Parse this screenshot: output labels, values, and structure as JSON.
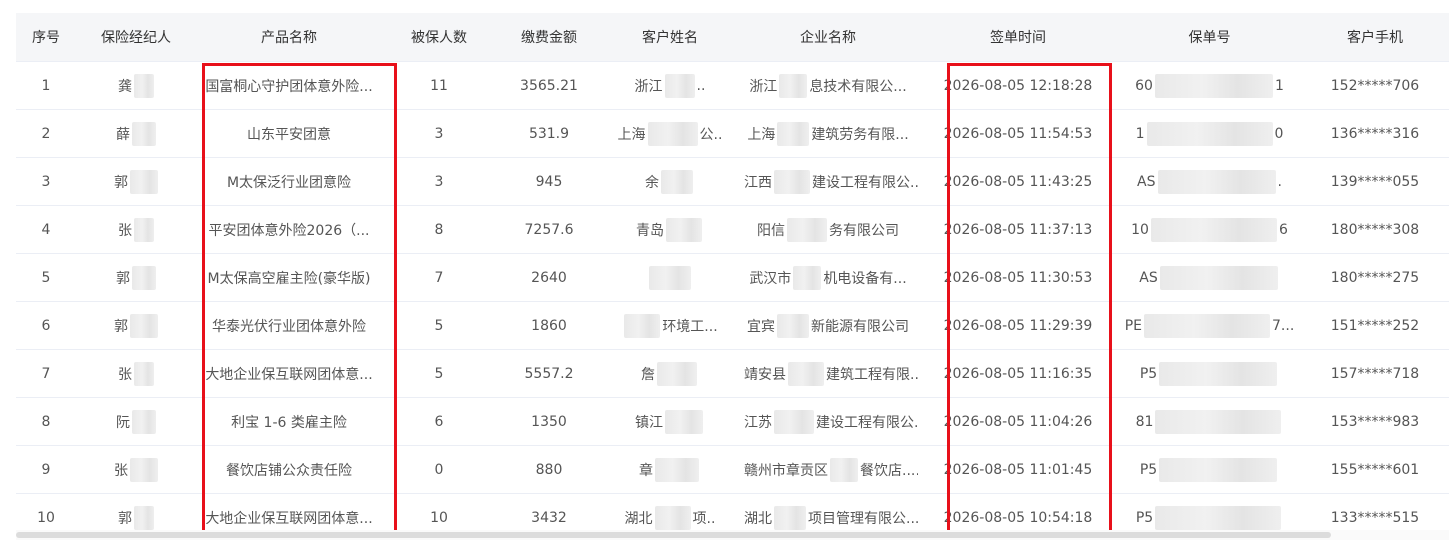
{
  "table": {
    "headers": [
      "序号",
      "保险经纪人",
      "产品名称",
      "被保人数",
      "缴费金额",
      "客户姓名",
      "企业名称",
      "签单时间",
      "保单号",
      "客户手机"
    ],
    "rows": [
      {
        "seq": "1",
        "broker": "龚",
        "product": "国富桐心守护团体意外险...",
        "insured": "11",
        "amount": "3565.21",
        "cust_pre": "浙江",
        "cust_suf": "..",
        "company_pre": "浙江",
        "company_suf": "息技术有限公...",
        "time": "2026-08-05 12:18:28",
        "policy_pre": "60",
        "policy_suf": "1",
        "phone": "152*****706"
      },
      {
        "seq": "2",
        "broker": "薛",
        "product": "山东平安团意",
        "insured": "3",
        "amount": "531.9",
        "cust_pre": "上海",
        "cust_suf": "公..",
        "company_pre": "上海",
        "company_suf": "建筑劳务有限...",
        "time": "2026-08-05 11:54:53",
        "policy_pre": "1",
        "policy_suf": "0",
        "phone": "136*****316"
      },
      {
        "seq": "3",
        "broker": "郭",
        "product": "M太保泛行业团意险",
        "insured": "3",
        "amount": "945",
        "cust_pre": "余",
        "cust_suf": "",
        "company_pre": "江西",
        "company_suf": "建设工程有限公...",
        "time": "2026-08-05 11:43:25",
        "policy_pre": "AS",
        "policy_suf": ".",
        "phone": "139*****055"
      },
      {
        "seq": "4",
        "broker": "张",
        "product": "平安团体意外险2026（...",
        "insured": "8",
        "amount": "7257.6",
        "cust_pre": "青岛",
        "cust_suf": "",
        "company_pre": "阳信",
        "company_suf": "务有限公司",
        "time": "2026-08-05 11:37:13",
        "policy_pre": "10",
        "policy_suf": "6",
        "phone": "180*****308"
      },
      {
        "seq": "5",
        "broker": "郭",
        "product": "M太保高空雇主险(豪华版)",
        "insured": "7",
        "amount": "2640",
        "cust_pre": "",
        "cust_suf": "",
        "company_pre": "武汉市",
        "company_suf": "机电设备有...",
        "time": "2026-08-05 11:30:53",
        "policy_pre": "AS",
        "policy_suf": "",
        "phone": "180*****275"
      },
      {
        "seq": "6",
        "broker": "郭",
        "product": "华泰光伏行业团体意外险",
        "insured": "5",
        "amount": "1860",
        "cust_pre": "",
        "cust_suf": "环境工...",
        "company_pre": "宜宾",
        "company_suf": "新能源有限公司",
        "time": "2026-08-05 11:29:39",
        "policy_pre": "PE",
        "policy_suf": "7...",
        "phone": "151*****252"
      },
      {
        "seq": "7",
        "broker": "张",
        "product": "大地企业保互联网团体意...",
        "insured": "5",
        "amount": "5557.2",
        "cust_pre": "詹",
        "cust_suf": "",
        "company_pre": "靖安县",
        "company_suf": "建筑工程有限...",
        "time": "2026-08-05 11:16:35",
        "policy_pre": "P5",
        "policy_suf": "",
        "phone": "157*****718"
      },
      {
        "seq": "8",
        "broker": "阮",
        "product": "利宝 1-6 类雇主险",
        "insured": "6",
        "amount": "1350",
        "cust_pre": "镇江",
        "cust_suf": "",
        "company_pre": "江苏",
        "company_suf": "建设工程有限公...",
        "time": "2026-08-05 11:04:26",
        "policy_pre": "81",
        "policy_suf": "",
        "phone": "153*****983"
      },
      {
        "seq": "9",
        "broker": "张",
        "product": "餐饮店铺公众责任险",
        "insured": "0",
        "amount": "880",
        "cust_pre": "章",
        "cust_suf": "",
        "company_pre": "赣州市章贡区",
        "company_suf": "餐饮店...",
        "time": "2026-08-05 11:01:45",
        "policy_pre": "P5",
        "policy_suf": "",
        "phone": "155*****601"
      },
      {
        "seq": "10",
        "broker": "郭",
        "product": "大地企业保互联网团体意...",
        "insured": "10",
        "amount": "3432",
        "cust_pre": "湖北",
        "cust_suf": "项..",
        "company_pre": "湖北",
        "company_suf": "项目管理有限公...",
        "time": "2026-08-05 10:54:18",
        "policy_pre": "P5",
        "policy_suf": "",
        "phone": "133*****515"
      }
    ]
  },
  "highlight_color": "#e8101a"
}
